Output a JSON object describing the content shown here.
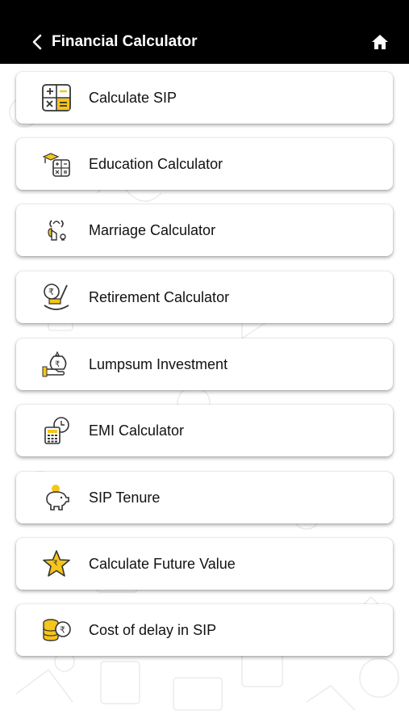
{
  "header": {
    "title": "Financial Calculator",
    "back_icon": "chevron-left-icon",
    "home_icon": "home-icon"
  },
  "colors": {
    "header_bg": "#000000",
    "accent": "#F5C518",
    "icon_stroke": "#333333"
  },
  "menu": [
    {
      "label": "Calculate SIP",
      "icon": "calculator-grid-icon"
    },
    {
      "label": "Education Calculator",
      "icon": "graduation-calculator-icon"
    },
    {
      "label": "Marriage Calculator",
      "icon": "marriage-hands-icon"
    },
    {
      "label": "Retirement Calculator",
      "icon": "rocking-chair-rupee-icon"
    },
    {
      "label": "Lumpsum Investment",
      "icon": "hand-money-bag-icon"
    },
    {
      "label": "EMI Calculator",
      "icon": "calculator-clock-icon"
    },
    {
      "label": "SIP Tenure",
      "icon": "piggy-bank-icon"
    },
    {
      "label": "Calculate Future Value",
      "icon": "star-rupee-icon"
    },
    {
      "label": "Cost of delay in SIP",
      "icon": "coin-stack-rupee-icon"
    }
  ]
}
